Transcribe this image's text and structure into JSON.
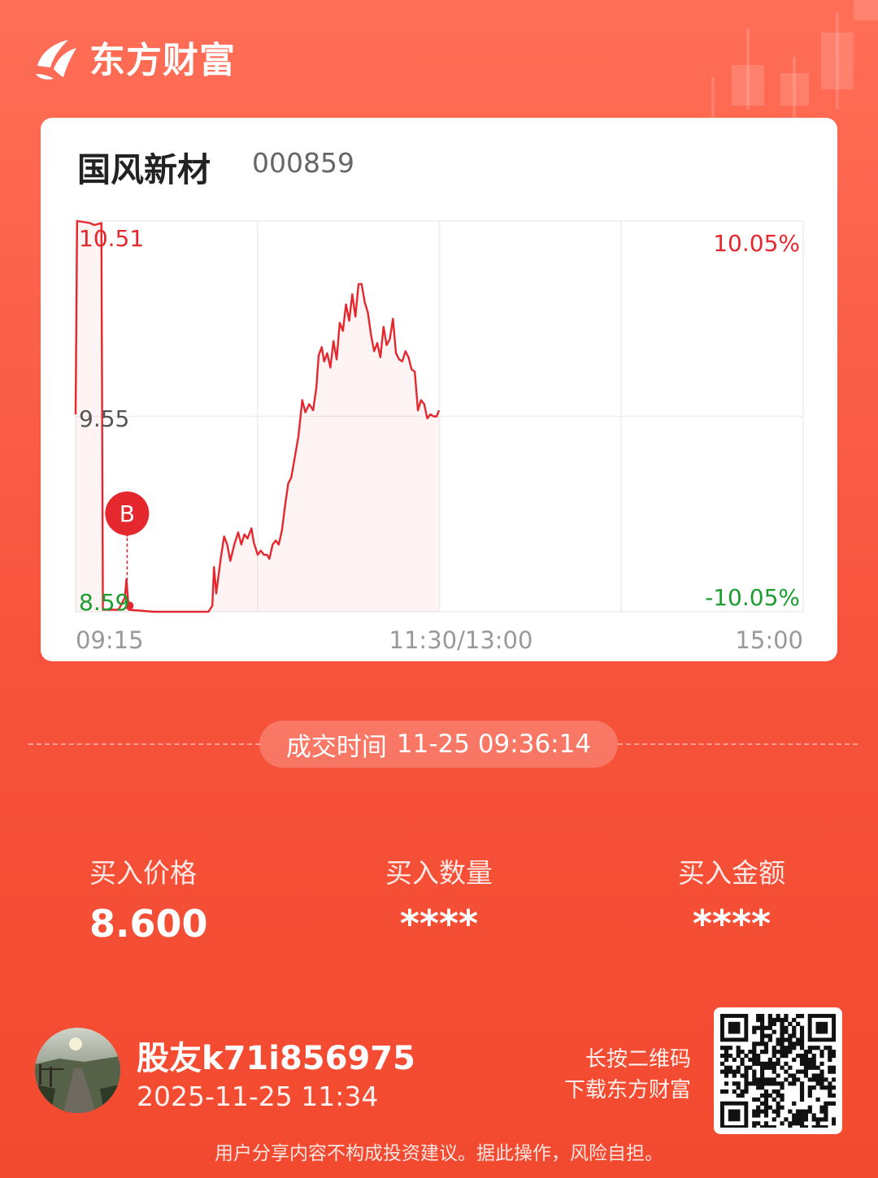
{
  "brand": {
    "name": "东方财富"
  },
  "stock": {
    "name": "国风新材",
    "code": "000859"
  },
  "chart_data": {
    "type": "line",
    "title": "",
    "price_axis": {
      "top": "10.51",
      "mid": "9.55",
      "bottom": "8.59"
    },
    "pct_axis": {
      "top": "10.05%",
      "bottom": "-10.05%"
    },
    "time_axis": [
      "09:15",
      "11:30/13:00",
      "15:00"
    ],
    "ylim": [
      8.59,
      10.51
    ],
    "marker": {
      "label": "B",
      "time": "09:36",
      "price": 8.6
    },
    "series": [
      {
        "values": [
          [
            0,
            9.56
          ],
          [
            2,
            10.51
          ],
          [
            18,
            10.5
          ],
          [
            24,
            10.49
          ],
          [
            33,
            10.5
          ],
          [
            35,
            8.6
          ],
          [
            55,
            8.6
          ],
          [
            63,
            8.66
          ],
          [
            65,
            8.75
          ],
          [
            68,
            8.6
          ],
          [
            100,
            8.59
          ],
          [
            170,
            8.59
          ],
          [
            175,
            8.62
          ],
          [
            177,
            8.81
          ],
          [
            180,
            8.68
          ],
          [
            186,
            8.86
          ],
          [
            190,
            8.96
          ],
          [
            194,
            8.92
          ],
          [
            198,
            8.84
          ],
          [
            203,
            8.92
          ],
          [
            208,
            8.98
          ],
          [
            212,
            8.92
          ],
          [
            216,
            8.97
          ],
          [
            220,
            8.95
          ],
          [
            225,
            9.0
          ],
          [
            228,
            8.93
          ],
          [
            233,
            8.87
          ],
          [
            237,
            8.89
          ],
          [
            241,
            8.87
          ],
          [
            245,
            8.87
          ],
          [
            248,
            8.85
          ],
          [
            252,
            8.92
          ],
          [
            256,
            8.94
          ],
          [
            260,
            8.92
          ],
          [
            264,
            8.99
          ],
          [
            268,
            9.11
          ],
          [
            272,
            9.22
          ],
          [
            276,
            9.25
          ],
          [
            281,
            9.36
          ],
          [
            285,
            9.45
          ],
          [
            290,
            9.63
          ],
          [
            294,
            9.57
          ],
          [
            299,
            9.61
          ],
          [
            304,
            9.58
          ],
          [
            308,
            9.69
          ],
          [
            311,
            9.85
          ],
          [
            315,
            9.89
          ],
          [
            318,
            9.82
          ],
          [
            322,
            9.86
          ],
          [
            326,
            9.79
          ],
          [
            330,
            9.92
          ],
          [
            334,
            9.83
          ],
          [
            338,
            10.01
          ],
          [
            342,
            9.97
          ],
          [
            346,
            10.1
          ],
          [
            350,
            10.02
          ],
          [
            354,
            10.15
          ],
          [
            358,
            10.04
          ],
          [
            362,
            10.2
          ],
          [
            366,
            10.2
          ],
          [
            370,
            10.11
          ],
          [
            374,
            10.06
          ],
          [
            378,
            9.95
          ],
          [
            382,
            9.87
          ],
          [
            386,
            9.91
          ],
          [
            390,
            9.84
          ],
          [
            394,
            9.99
          ],
          [
            398,
            9.9
          ],
          [
            402,
            9.93
          ],
          [
            406,
            10.03
          ],
          [
            410,
            9.86
          ],
          [
            414,
            9.83
          ],
          [
            418,
            9.82
          ],
          [
            422,
            9.87
          ],
          [
            426,
            9.84
          ],
          [
            430,
            9.78
          ],
          [
            434,
            9.77
          ],
          [
            438,
            9.58
          ],
          [
            442,
            9.63
          ],
          [
            446,
            9.61
          ],
          [
            450,
            9.54
          ],
          [
            454,
            9.56
          ],
          [
            458,
            9.55
          ],
          [
            462,
            9.55
          ],
          [
            465,
            9.58
          ]
        ]
      }
    ],
    "grid": true
  },
  "trade": {
    "label": "成交时间",
    "time": "11-25 09:36:14"
  },
  "stats": [
    {
      "label": "买入价格",
      "value": "8.600"
    },
    {
      "label": "买入数量",
      "value": "****"
    },
    {
      "label": "买入金额",
      "value": "****"
    }
  ],
  "user": {
    "name": "股友k71i856975",
    "time": "2025-11-25 11:34"
  },
  "qr": {
    "hint_line1": "长按二维码",
    "hint_line2": "下载东方财富"
  },
  "disclaimer": "用户分享内容不构成投资建议。据此操作，风险自担。",
  "colors": {
    "up": "#e5272e",
    "down": "#1b9e2f",
    "card_bg": "#ffffff"
  }
}
